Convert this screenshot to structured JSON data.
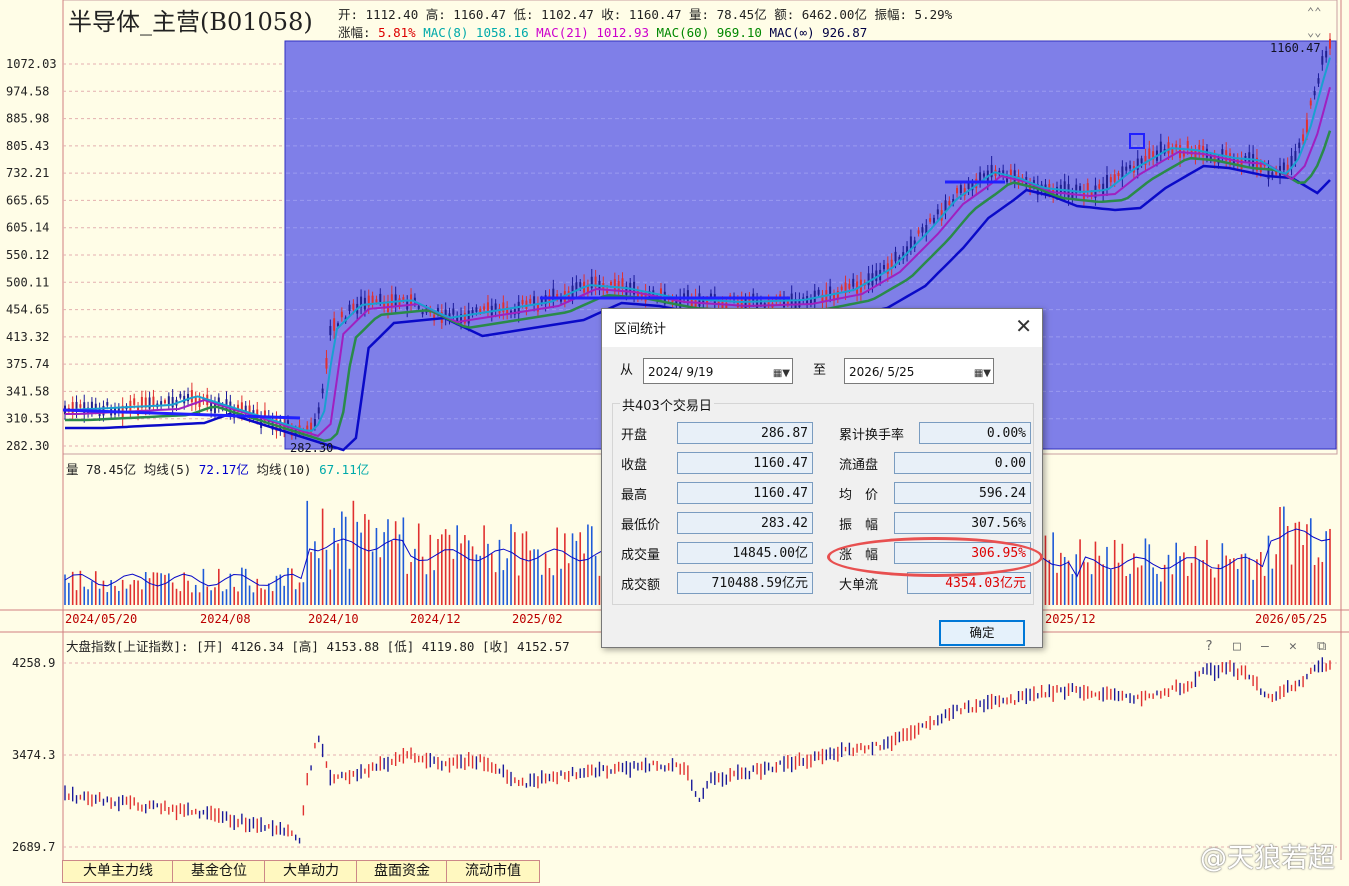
{
  "colors": {
    "bg": "#fffde7",
    "selection": "#7f7fe8",
    "up": "#e03030",
    "down": "#1e5ad8",
    "ma_blue": "#0a0ac8",
    "ma_green": "#2a8a4a",
    "ma_cyan": "#1aa0d0",
    "ma_purple": "#a020c0"
  },
  "header": {
    "title": "半导体_主营(B01058)",
    "ohlc": "开: 1112.40 高: 1160.47 低: 1102.47 收: 1160.47 量: 78.45亿 额: 6462.00亿 振幅: 5.29%",
    "change_label": "涨幅: ",
    "change_value": "5.81%",
    "mac8": "MAC(8) 1058.16",
    "mac21": "MAC(21) 1012.93",
    "mac60": "MAC(60) 969.10",
    "macinf": "MAC(∞) 926.87"
  },
  "price_axis": {
    "labels": [
      "1072.03",
      "974.58",
      "885.98",
      "805.43",
      "732.21",
      "665.65",
      "605.14",
      "550.12",
      "500.11",
      "454.65",
      "413.32",
      "375.74",
      "341.58",
      "310.53",
      "282.30"
    ]
  },
  "price_marks": {
    "high_label": "1160.47",
    "low_label": "282.30"
  },
  "volume": {
    "label": "量 78.45亿",
    "ma5_label": "均线(5) ",
    "ma5_value": "72.17亿",
    "ma10_label": "均线(10) ",
    "ma10_value": "67.11亿"
  },
  "date_axis": [
    "2024/05/20",
    "2024/08",
    "2024/10",
    "2024/12",
    "2025/02",
    "2025/12",
    "2026/05/25"
  ],
  "index_panel": {
    "legend": "大盘指数[上证指数]: [开] 4126.34 [高] 4153.88 [低] 4119.80 [收] 4152.57",
    "axis": [
      "4258.9",
      "3474.3",
      "2689.7"
    ]
  },
  "dialog": {
    "title": "区间统计",
    "from_label": "从",
    "from_date": "2024/  9/19",
    "to_label": "至",
    "to_date": "2026/  5/25",
    "days": "共403个交易日",
    "left": [
      {
        "label": "开盘",
        "value": "286.87"
      },
      {
        "label": "收盘",
        "value": "1160.47"
      },
      {
        "label": "最高",
        "value": "1160.47"
      },
      {
        "label": "最低价",
        "value": "283.42"
      },
      {
        "label": "成交量",
        "value": "14845.00亿"
      },
      {
        "label": "成交额",
        "value": "710488.59亿元"
      }
    ],
    "right": [
      {
        "label": "累计换手率",
        "value": "0.00%"
      },
      {
        "label": "流通盘",
        "value": "0.00"
      },
      {
        "label": "均　价",
        "value": "596.24"
      },
      {
        "label": "振　幅",
        "value": "307.56%"
      },
      {
        "label": "涨　幅",
        "value": "306.95%"
      },
      {
        "label": "大单流",
        "value": "4354.03亿元"
      }
    ],
    "ok": "确定"
  },
  "tabs": [
    "大单主力线",
    "基金仓位",
    "大单动力",
    "盘面资金",
    "流动市值"
  ],
  "watermark": "@天狼若超"
}
